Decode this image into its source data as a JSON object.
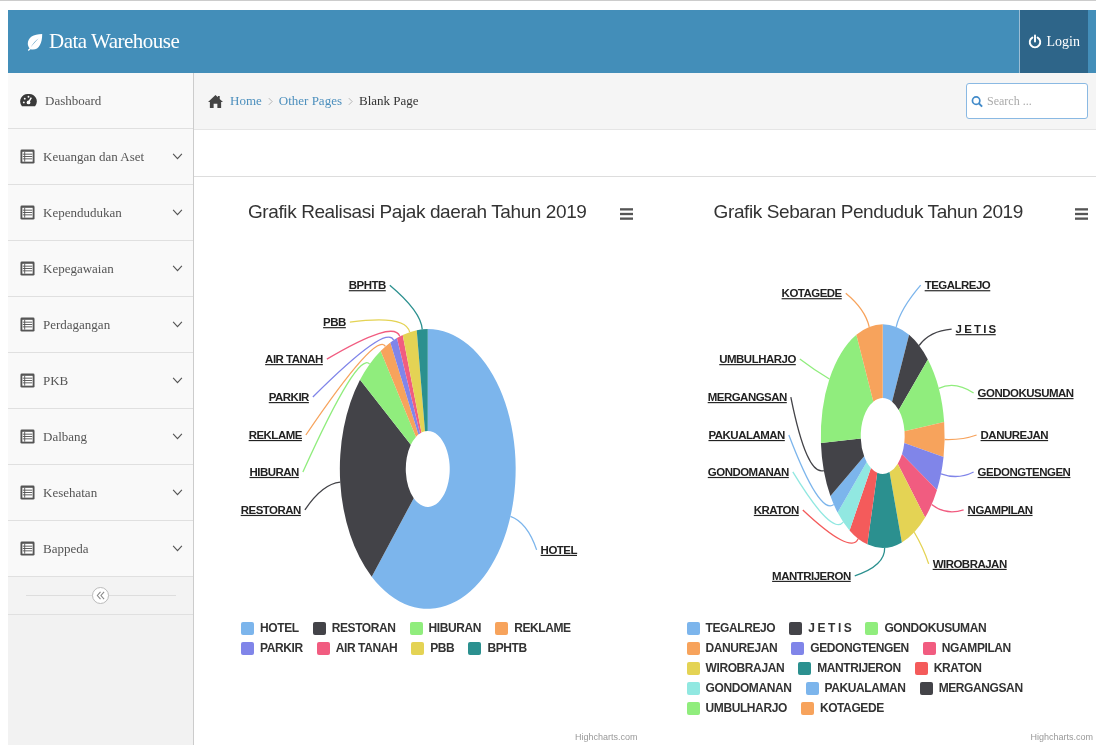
{
  "header": {
    "brand": "Data Warehouse",
    "login": "Login"
  },
  "sidebar": {
    "items": [
      {
        "label": "Dashboard",
        "kind": "dashboard"
      },
      {
        "label": "Keuangan dan Aset",
        "kind": "menu"
      },
      {
        "label": "Kependudukan",
        "kind": "menu"
      },
      {
        "label": "Kepegawaian",
        "kind": "menu"
      },
      {
        "label": "Perdagangan",
        "kind": "menu"
      },
      {
        "label": "PKB",
        "kind": "menu"
      },
      {
        "label": "Dalbang",
        "kind": "menu"
      },
      {
        "label": "Kesehatan",
        "kind": "menu"
      },
      {
        "label": "Bappeda",
        "kind": "menu"
      }
    ]
  },
  "breadcrumb": [
    {
      "label": "Home",
      "link": true
    },
    {
      "label": "Other Pages",
      "link": true
    },
    {
      "label": "Blank Page",
      "link": false
    }
  ],
  "search": {
    "placeholder": "Search ..."
  },
  "charts": [
    {
      "title": "Grafik Realisasi Pajak daerah Tahun 2019",
      "credit": "Highcharts.com",
      "data_labels": [
        "BPHTB",
        "PBB",
        "AIR TANAH",
        "PARKIR",
        "REKLAME",
        "HIBURAN",
        "RESTORAN",
        "HOTEL"
      ],
      "series": [
        {
          "name": "HOTEL",
          "color": "#7cb5ec"
        },
        {
          "name": "RESTORAN",
          "color": "#434348"
        },
        {
          "name": "HIBURAN",
          "color": "#90ed7d"
        },
        {
          "name": "REKLAME",
          "color": "#f7a35c"
        },
        {
          "name": "PARKIR",
          "color": "#8085e9"
        },
        {
          "name": "AIR TANAH",
          "color": "#f15c80"
        },
        {
          "name": "PBB",
          "color": "#e4d354"
        },
        {
          "name": "BPHTB",
          "color": "#2b908f"
        }
      ]
    },
    {
      "title": "Grafik Sebaran Penduduk Tahun 2019",
      "credit": "Highcharts.com",
      "data_labels": [
        "TEGALREJO",
        "KOTAGEDE",
        "J E T I S",
        "UMBULHARJO",
        "GONDOKUSUMAN",
        "MERGANGSAN",
        "PAKUALAMAN",
        "DANUREJAN",
        "GONDOMANAN",
        "GEDONGTENGEN",
        "KRATON",
        "NGAMPILAN",
        "WIROBRAJAN",
        "MANTRIJERON"
      ],
      "series": [
        {
          "name": "TEGALREJO",
          "color": "#7cb5ec"
        },
        {
          "name": "J E T I S",
          "color": "#434348"
        },
        {
          "name": "GONDOKUSUMAN",
          "color": "#90ed7d"
        },
        {
          "name": "DANUREJAN",
          "color": "#f7a35c"
        },
        {
          "name": "GEDONGTENGEN",
          "color": "#8085e9"
        },
        {
          "name": "NGAMPILAN",
          "color": "#f15c80"
        },
        {
          "name": "WIROBRAJAN",
          "color": "#e4d354"
        },
        {
          "name": "MANTRIJERON",
          "color": "#2b908f"
        },
        {
          "name": "KRATON",
          "color": "#f45b5b"
        },
        {
          "name": "GONDOMANAN",
          "color": "#91e8e1"
        },
        {
          "name": "PAKUALAMAN",
          "color": "#7cb5ec"
        },
        {
          "name": "MERGANGSAN",
          "color": "#434348"
        },
        {
          "name": "UMBULHARJO",
          "color": "#90ed7d"
        },
        {
          "name": "KOTAGEDE",
          "color": "#f7a35c"
        }
      ]
    }
  ]
}
